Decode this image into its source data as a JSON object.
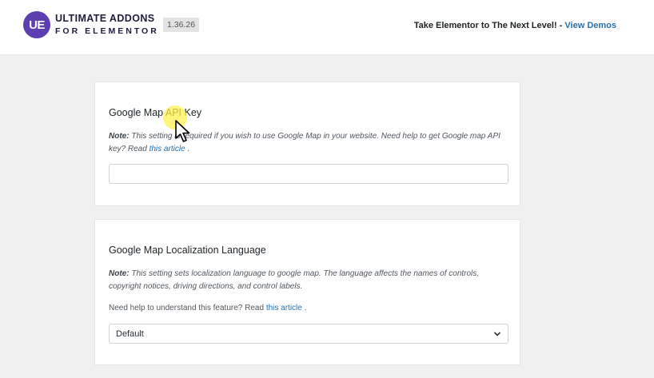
{
  "header": {
    "logo_mark": "UE",
    "logo_line1": "ULTIMATE ADDONS",
    "logo_line2": "FOR ELEMENTOR",
    "version": "1.36.26",
    "cta_text": "Take Elementor to The Next Level! -",
    "cta_link": "View Demos"
  },
  "api_key_section": {
    "title": "Google Map API Key",
    "note_label": "Note:",
    "note_text": "This setting is required if you wish to use Google Map in your website. Need help to get Google map API key? Read",
    "note_link": "this article",
    "note_end": ".",
    "input_value": "",
    "input_placeholder": ""
  },
  "language_section": {
    "title": "Google Map Localization Language",
    "note_label": "Note:",
    "note_text": "This setting sets localization language to google map. The language affects the names of controls, copyright notices, driving directions, and control labels.",
    "help_text": "Need help to understand this feature? Read",
    "help_link": "this article",
    "help_end": ".",
    "selected_language": "Default"
  },
  "colors": {
    "brand": "#5d3fb0",
    "link": "#2271b1",
    "background": "#f0f0f1"
  },
  "icons": {
    "dropdown": "chevron-down-icon",
    "cursor": "mouse-pointer-icon"
  }
}
